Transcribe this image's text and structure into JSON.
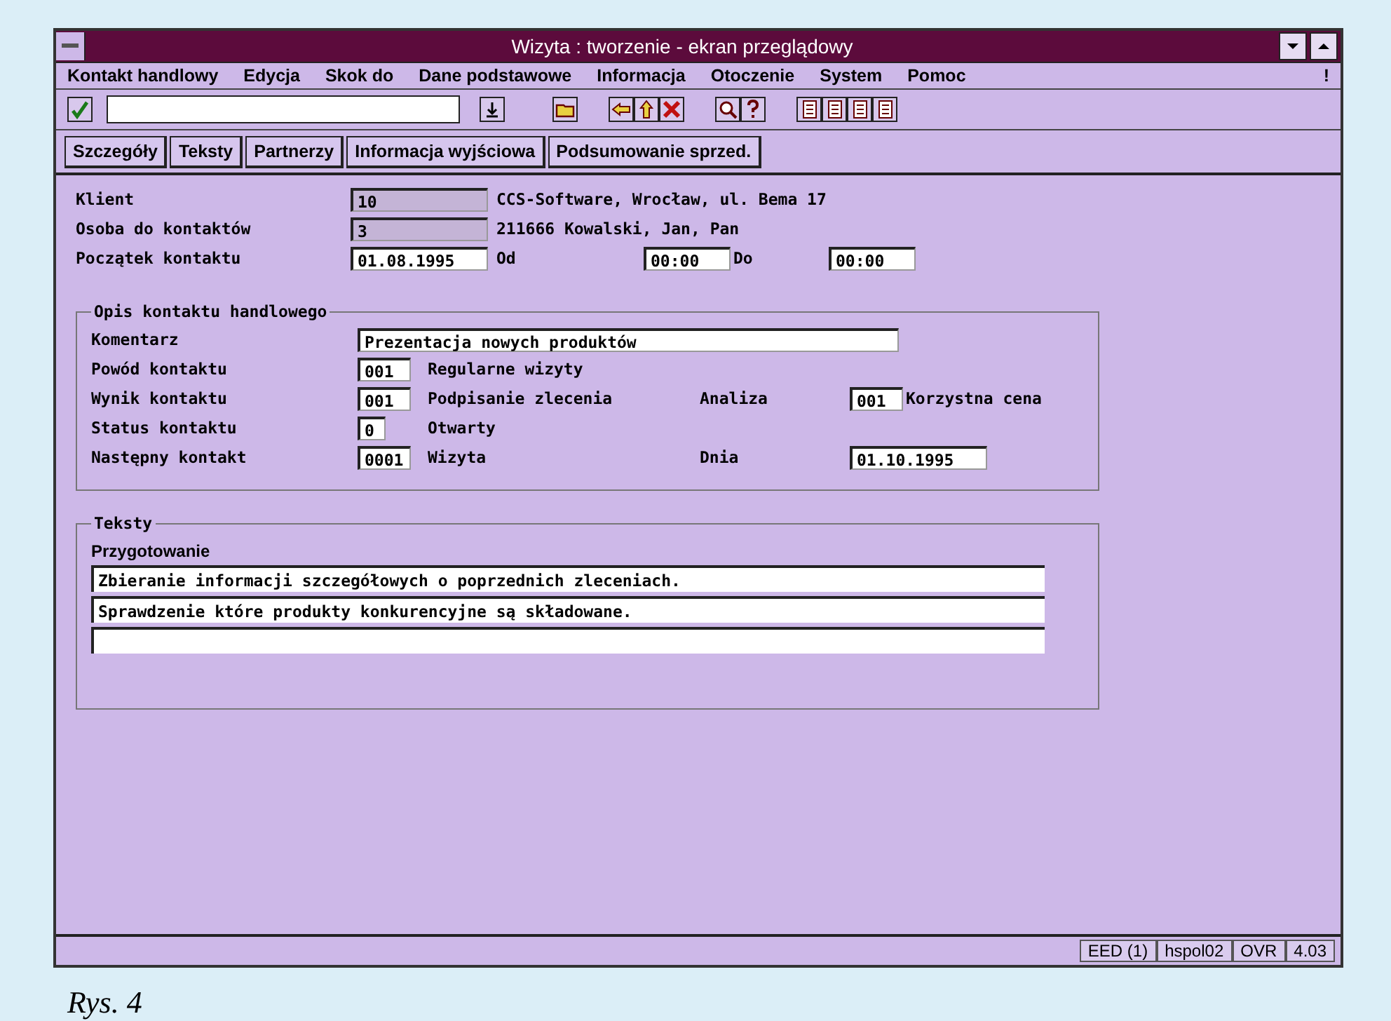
{
  "window": {
    "title": "Wizyta : tworzenie - ekran przeglądowy"
  },
  "menu": [
    "Kontakt handlowy",
    "Edycja",
    "Skok do",
    "Dane podstawowe",
    "Informacja",
    "Otoczenie",
    "System",
    "Pomoc",
    "!"
  ],
  "tabs": [
    "Szczegóły",
    "Teksty",
    "Partnerzy",
    "Informacja wyjściowa",
    "Podsumowanie sprzed."
  ],
  "header_rows": [
    {
      "cells": [
        {
          "kind": "label",
          "text": "Klient"
        },
        {
          "kind": "date",
          "value": "10",
          "disabled": true
        },
        {
          "kind": "text",
          "text": "CCS-Software, Wrocław, ul. Bema 17"
        }
      ]
    },
    {
      "cells": [
        {
          "kind": "label",
          "text": "Osoba do kontaktów"
        },
        {
          "kind": "date",
          "value": "3",
          "disabled": true
        },
        {
          "kind": "text",
          "text": "211666 Kowalski, Jan, Pan"
        }
      ]
    },
    {
      "cells": [
        {
          "kind": "label",
          "text": "Początek kontaktu"
        },
        {
          "kind": "date",
          "value": "01.08.1995",
          "disabled": false
        },
        {
          "kind": "text",
          "text": "Od"
        },
        {
          "kind": "time",
          "value": "00:00",
          "disabled": false
        },
        {
          "kind": "text",
          "text": "Do"
        },
        {
          "kind": "time",
          "value": "00:00",
          "disabled": false
        }
      ]
    }
  ],
  "description": {
    "title": "Opis kontaktu handlowego",
    "rows": [
      {
        "cells": [
          {
            "kind": "label",
            "text": "Komentarz"
          },
          {
            "kind": "wide",
            "value": "Prezentacja nowych produktów",
            "disabled": false
          }
        ]
      },
      {
        "cells": [
          {
            "kind": "label",
            "text": "Powód kontaktu"
          },
          {
            "kind": "code",
            "value": "001",
            "disabled": false
          },
          {
            "kind": "text",
            "text": "Regularne wizyty"
          }
        ]
      },
      {
        "cells": [
          {
            "kind": "label",
            "text": "Wynik kontaktu"
          },
          {
            "kind": "code",
            "value": "001",
            "disabled": false
          },
          {
            "kind": "text",
            "text": "Podpisanie zlecenia"
          },
          {
            "kind": "text",
            "text": "Analiza"
          },
          {
            "kind": "code",
            "value": "001",
            "disabled": false
          },
          {
            "kind": "text",
            "text": "Korzystna cena"
          }
        ]
      },
      {
        "cells": [
          {
            "kind": "label",
            "text": "Status kontaktu"
          },
          {
            "kind": "short",
            "value": "0",
            "disabled": false
          },
          {
            "kind": "text",
            "text": "Otwarty"
          }
        ]
      },
      {
        "cells": [
          {
            "kind": "label",
            "text": "Następny kontakt"
          },
          {
            "kind": "code",
            "value": "0001",
            "disabled": false
          },
          {
            "kind": "text",
            "text": "Wizyta"
          },
          {
            "kind": "text",
            "text": "Dnia"
          },
          {
            "kind": "date",
            "value": "01.10.1995",
            "disabled": false
          }
        ]
      }
    ]
  },
  "texts": {
    "title": "Teksty",
    "label": "Przygotowanie",
    "lines": [
      {
        "kind": "line",
        "value": "Zbieranie informacji szczegółowych o poprzednich zleceniach."
      },
      {
        "kind": "line",
        "value": "Sprawdzenie które produkty konkurencyjne są składowane."
      },
      {
        "kind": "empty"
      }
    ]
  },
  "status_bar": [
    "EED (1)",
    "hspol02",
    "OVR",
    "4.03"
  ],
  "caption": "Rys. 4"
}
